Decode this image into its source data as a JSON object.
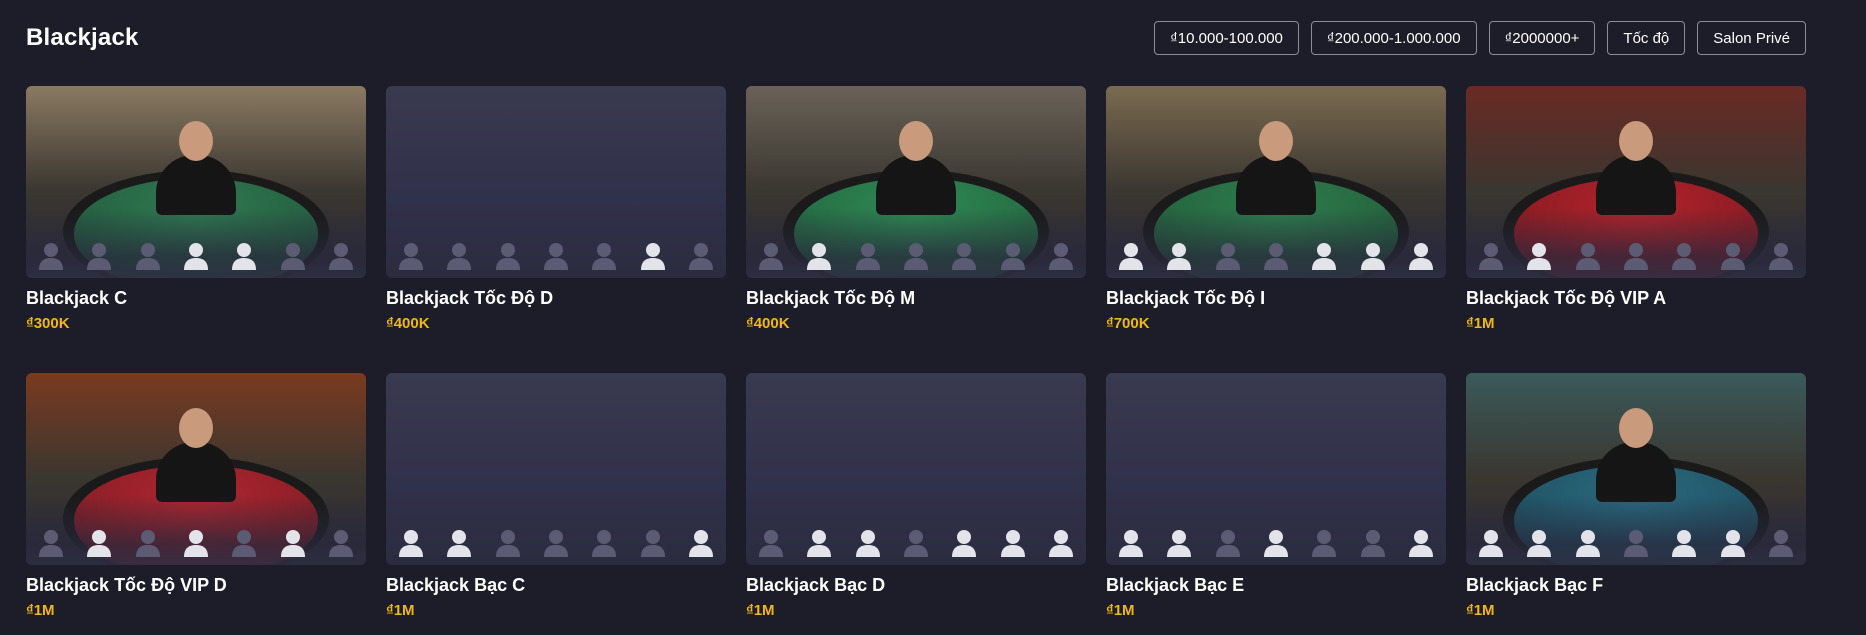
{
  "page": {
    "title": "Blackjack"
  },
  "filters": [
    "₫10.000-100.000",
    "₫200.000-1.000.000",
    "₫2000000+",
    "Tốc độ",
    "Salon Privé"
  ],
  "colors": {
    "background": "#1d1d2a",
    "bet_accent": "#f0b90b",
    "seat_taken": "#e3e3ea",
    "seat_free": "#5b5c73"
  },
  "tables": [
    {
      "name": "Blackjack C",
      "bet": "₫300K",
      "has_image": true,
      "felt": "#2f7a52",
      "backdrop": "#8a7a62",
      "seats": [
        0,
        0,
        0,
        1,
        1,
        0,
        0
      ]
    },
    {
      "name": "Blackjack Tốc Độ D",
      "bet": "₫400K",
      "has_image": false,
      "felt": "",
      "backdrop": "",
      "seats": [
        0,
        0,
        0,
        0,
        0,
        1,
        0
      ]
    },
    {
      "name": "Blackjack Tốc Độ M",
      "bet": "₫400K",
      "has_image": true,
      "felt": "#2f8a55",
      "backdrop": "#6a6258",
      "seats": [
        0,
        1,
        0,
        0,
        0,
        0,
        0
      ]
    },
    {
      "name": "Blackjack Tốc Độ I",
      "bet": "₫700K",
      "has_image": true,
      "felt": "#2e7e4e",
      "backdrop": "#7a6a50",
      "seats": [
        1,
        1,
        0,
        0,
        1,
        1,
        1
      ]
    },
    {
      "name": "Blackjack Tốc Độ VIP A",
      "bet": "₫1M",
      "has_image": true,
      "felt": "#b3232c",
      "backdrop": "#6a2a24",
      "seats": [
        0,
        1,
        0,
        0,
        0,
        0,
        0
      ]
    },
    {
      "name": "Blackjack Tốc Độ VIP D",
      "bet": "₫1M",
      "has_image": true,
      "felt": "#b02630",
      "backdrop": "#7a3a20",
      "seats": [
        0,
        1,
        0,
        1,
        0,
        1,
        0
      ]
    },
    {
      "name": "Blackjack Bạc C",
      "bet": "₫1M",
      "has_image": false,
      "felt": "",
      "backdrop": "",
      "seats": [
        1,
        1,
        0,
        0,
        0,
        0,
        1
      ]
    },
    {
      "name": "Blackjack Bạc D",
      "bet": "₫1M",
      "has_image": false,
      "felt": "",
      "backdrop": "",
      "seats": [
        0,
        1,
        1,
        0,
        1,
        1,
        1
      ]
    },
    {
      "name": "Blackjack Bạc E",
      "bet": "₫1M",
      "has_image": false,
      "felt": "",
      "backdrop": "",
      "seats": [
        1,
        1,
        0,
        1,
        0,
        0,
        1
      ]
    },
    {
      "name": "Blackjack Bạc F",
      "bet": "₫1M",
      "has_image": true,
      "felt": "#2a6a80",
      "backdrop": "#3a5a5a",
      "seats": [
        1,
        1,
        1,
        0,
        1,
        1,
        0
      ]
    }
  ]
}
